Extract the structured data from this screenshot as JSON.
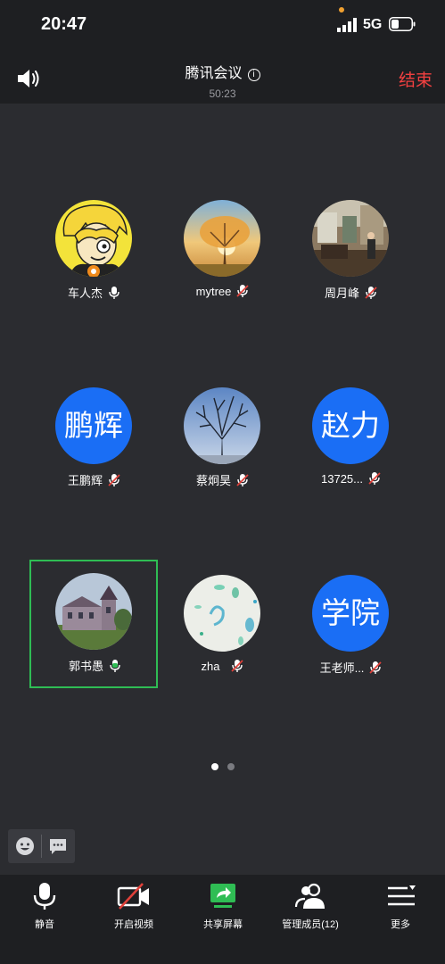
{
  "status": {
    "time": "20:47",
    "network": "5G"
  },
  "meeting": {
    "title": "腾讯会议",
    "duration": "50:23",
    "end_label": "结束"
  },
  "participants": [
    {
      "name": "车人杰",
      "avatar": "cartoon-photo",
      "mic": "on"
    },
    {
      "name": "mytree",
      "avatar": "tree-sunset-photo",
      "mic": "muted"
    },
    {
      "name": "周月峰",
      "avatar": "room-photo",
      "mic": "muted"
    },
    {
      "name": "王鹏辉",
      "avatar_text": "鹏辉",
      "mic": "muted"
    },
    {
      "name": "蔡炯昊",
      "avatar": "bare-tree-photo",
      "mic": "muted"
    },
    {
      "name": "13725...",
      "avatar_text": "赵力",
      "mic": "muted"
    },
    {
      "name": "郭书愚",
      "avatar": "castle-photo",
      "mic": "speaking",
      "active": true
    },
    {
      "name": "zha",
      "avatar": "paint-drops-photo",
      "mic": "muted"
    },
    {
      "name": "王老师...",
      "avatar_text": "学院",
      "mic": "muted"
    }
  ],
  "pager": {
    "pages": 2,
    "current": 1
  },
  "toolbar": {
    "mute_label": "静音",
    "video_label": "开启视频",
    "share_label": "共享屏幕",
    "members_label": "管理成员(12)",
    "more_label": "更多"
  },
  "colors": {
    "accent_blue": "#1a6ef5",
    "end_red": "#f24040",
    "speaking_green": "#2fbd54",
    "muted_red": "#e0413a"
  }
}
